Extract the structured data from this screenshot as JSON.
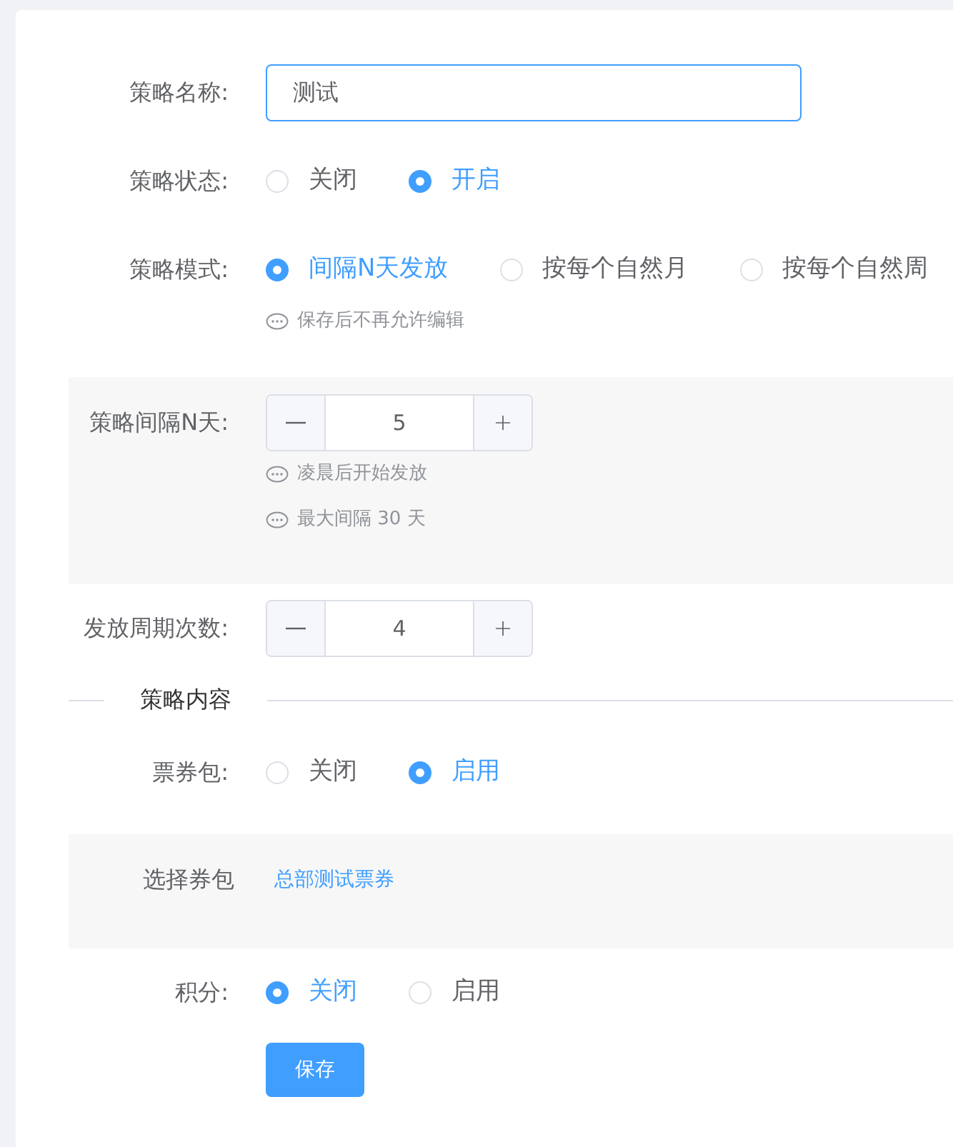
{
  "form": {
    "fields": [
      {
        "kind": "text",
        "label": "策略名称:",
        "value": "测试",
        "highlighted": false
      },
      {
        "kind": "radio",
        "label": "策略状态:",
        "highlighted": false,
        "options": [
          {
            "label": "关闭",
            "selected": false
          },
          {
            "label": "开启",
            "selected": true
          }
        ]
      },
      {
        "kind": "radio",
        "label": "策略模式:",
        "highlighted": false,
        "options": [
          {
            "label": "间隔N天发放",
            "selected": true
          },
          {
            "label": "按每个自然月",
            "selected": false
          },
          {
            "label": "按每个自然周",
            "selected": false
          }
        ],
        "hints": [
          "保存后不再允许编辑"
        ]
      },
      {
        "kind": "stepper",
        "label": "策略间隔N天:",
        "value": "5",
        "highlighted": true,
        "hints": [
          "凌晨后开始发放",
          "最大间隔 30 天"
        ]
      },
      {
        "kind": "stepper",
        "label": "发放周期次数:",
        "value": "4",
        "highlighted": false
      },
      {
        "kind": "divider",
        "label": "策略内容"
      },
      {
        "kind": "radio",
        "label": "票券包:",
        "highlighted": false,
        "options": [
          {
            "label": "关闭",
            "selected": false
          },
          {
            "label": "启用",
            "selected": true
          }
        ]
      },
      {
        "kind": "link",
        "label": "选择券包",
        "value": "总部测试票券",
        "highlighted": true
      },
      {
        "kind": "radio",
        "label": "积分:",
        "highlighted": false,
        "options": [
          {
            "label": "关闭",
            "selected": true
          },
          {
            "label": "启用",
            "selected": false
          }
        ]
      }
    ]
  },
  "save_button": "保存"
}
